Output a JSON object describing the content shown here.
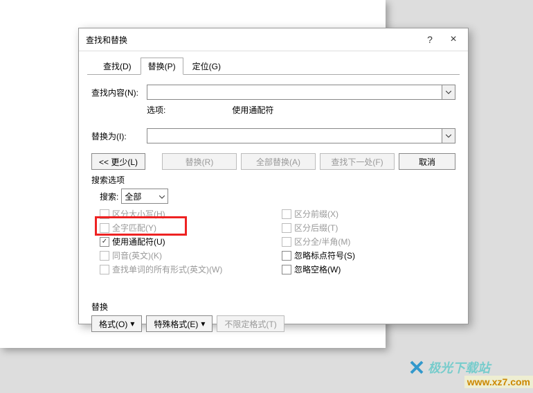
{
  "dialog": {
    "title": "查找和替换",
    "help_icon": "?",
    "close_icon": "×",
    "tabs": {
      "find": "查找(D)",
      "replace": "替换(P)",
      "goto": "定位(G)"
    },
    "fields": {
      "find_label": "查找内容(N):",
      "options_label": "选项:",
      "options_value": "使用通配符",
      "replace_label": "替换为(I):"
    },
    "buttons": {
      "less": "<< 更少(L)",
      "replace": "替换(R)",
      "replace_all": "全部替换(A)",
      "find_next": "查找下一处(F)",
      "cancel": "取消"
    },
    "search_options": {
      "group_label": "搜索选项",
      "search_label": "搜索:",
      "search_direction": "全部",
      "match_case": "区分大小写(H)",
      "whole_word": "全字匹配(Y)",
      "use_wildcards": "使用通配符(U)",
      "sounds_like": "同音(英文)(K)",
      "all_word_forms": "查找单词的所有形式(英文)(W)",
      "match_prefix": "区分前缀(X)",
      "match_suffix": "区分后缀(T)",
      "full_half": "区分全/半角(M)",
      "ignore_punct": "忽略标点符号(S)",
      "ignore_space": "忽略空格(W)"
    },
    "replace_section": {
      "label": "替换",
      "format_btn": "格式(O)",
      "special_btn": "特殊格式(E)",
      "no_format_btn": "不限定格式(T)"
    }
  },
  "watermark": {
    "line1": "极光下载站",
    "line2": "www.xz7.com"
  }
}
